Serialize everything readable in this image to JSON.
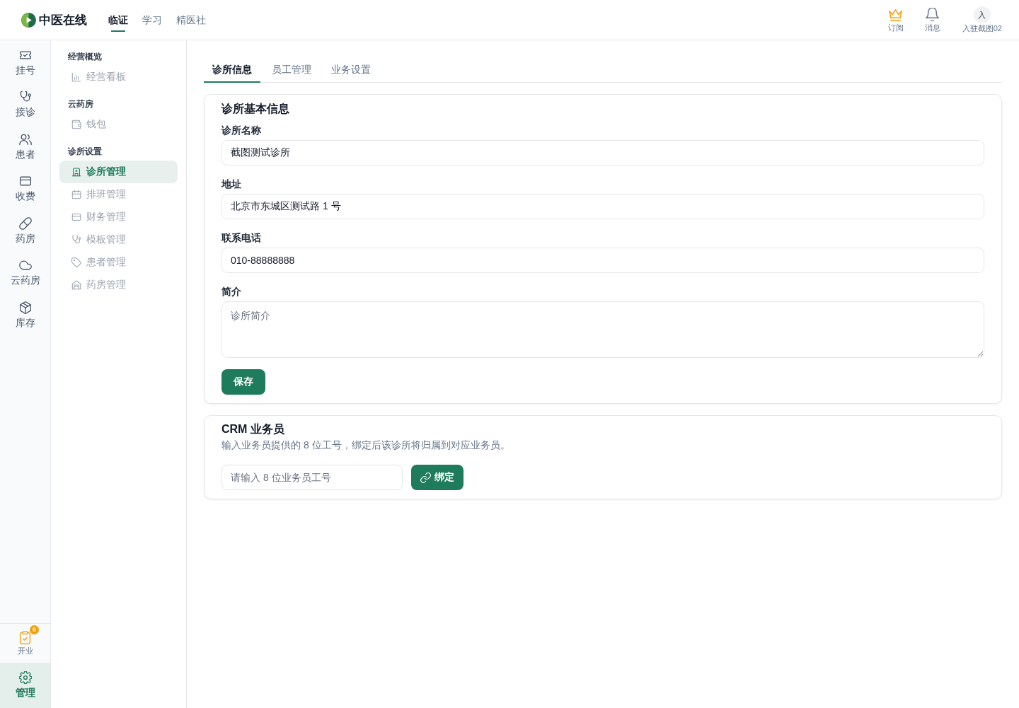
{
  "header": {
    "logo": "中医在线",
    "nav": [
      {
        "label": "临证",
        "selected": true
      },
      {
        "label": "学习",
        "selected": false
      },
      {
        "label": "精医社",
        "selected": false
      }
    ],
    "actions": [
      {
        "label": "订阅"
      },
      {
        "label": "消息"
      }
    ],
    "user": {
      "avatar": "入",
      "name": "入驻截图02"
    }
  },
  "rail": {
    "items": [
      {
        "label": "挂号",
        "selected": false
      },
      {
        "label": "接诊",
        "selected": false
      },
      {
        "label": "患者",
        "selected": false
      },
      {
        "label": "收费",
        "selected": false
      },
      {
        "label": "药房",
        "selected": false
      },
      {
        "label": "云药房",
        "selected": false
      },
      {
        "label": "库存",
        "selected": false
      }
    ],
    "bottom_items": [
      {
        "label": "开业",
        "badge": "6",
        "selected": false
      },
      {
        "label": "管理",
        "selected": true
      }
    ]
  },
  "sidebar": {
    "groups": [
      {
        "title": "经营概览",
        "items": [
          {
            "label": "经营看板",
            "selected": false
          }
        ]
      },
      {
        "title": "云药房",
        "items": [
          {
            "label": "钱包",
            "selected": false
          }
        ]
      },
      {
        "title": "诊所设置",
        "items": [
          {
            "label": "诊所管理",
            "selected": true
          },
          {
            "label": "排班管理",
            "selected": false
          },
          {
            "label": "财务管理",
            "selected": false
          },
          {
            "label": "模板管理",
            "selected": false
          },
          {
            "label": "患者管理",
            "selected": false
          },
          {
            "label": "药房管理",
            "selected": false
          }
        ]
      }
    ]
  },
  "tabs": [
    {
      "label": "诊所信息",
      "selected": true
    },
    {
      "label": "员工管理",
      "selected": false
    },
    {
      "label": "业务设置",
      "selected": false
    }
  ],
  "basic_info": {
    "title": "诊所基本信息",
    "fields": [
      {
        "kind": "input",
        "label": "诊所名称",
        "value": "截图测试诊所"
      },
      {
        "kind": "input",
        "label": "地址",
        "value": "北京市东城区测试路 1 号"
      },
      {
        "kind": "input",
        "label": "联系电话",
        "value": "010-88888888"
      },
      {
        "kind": "textarea",
        "label": "简介",
        "placeholder": "诊所简介"
      }
    ],
    "save_button": "保存"
  },
  "crm": {
    "title": "CRM 业务员",
    "description": "输入业务员提供的 8 位工号，绑定后该诊所将归属到对应业务员。",
    "input": {
      "placeholder": "请输入 8 位业务员工号"
    },
    "bind_button": "绑定"
  }
}
